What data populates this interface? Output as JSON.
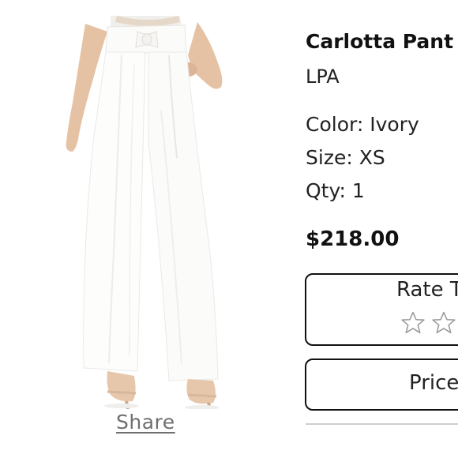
{
  "product": {
    "image_alt": "Model wearing ivory high-waisted wide-leg pants",
    "name": "Carlotta Pant",
    "brand": "LPA",
    "color": "Color: Ivory",
    "size": "Size: XS",
    "qty": "Qty: 1",
    "price": "$218.00"
  },
  "actions": {
    "share_label": "Share",
    "rate_label": "Rate T",
    "price_label": "Price"
  },
  "rating": {
    "max_stars": 5,
    "value": 0,
    "star_icon": "star-outline-icon"
  },
  "colors": {
    "text": "#111111",
    "muted": "#6f6f6f",
    "border": "#111111",
    "divider": "#cfcfcf",
    "star": "#9a9a9a"
  }
}
